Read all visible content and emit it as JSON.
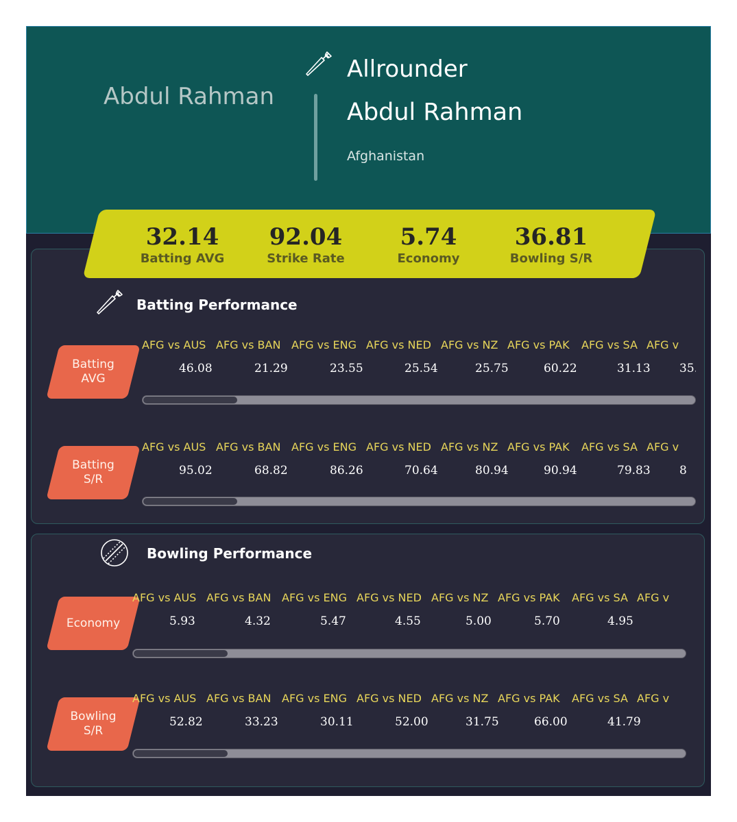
{
  "player": {
    "photo_name": "Abdul Rahman",
    "role": "Allrounder",
    "name": "Abdul Rahman",
    "country": "Afghanistan"
  },
  "summary": [
    {
      "value": "32.14",
      "label": "Batting AVG"
    },
    {
      "value": "92.04",
      "label": "Strike Rate"
    },
    {
      "value": "5.74",
      "label": "Economy"
    },
    {
      "value": "36.81",
      "label": "Bowling S/R"
    }
  ],
  "batting": {
    "title": "Batting Performance",
    "icon": "cricket-bat-icon",
    "rows": [
      {
        "label": "Batting\nAVG",
        "matches": [
          "AFG vs AUS",
          "AFG vs BAN",
          "AFG vs ENG",
          "AFG vs NED",
          "AFG vs NZ",
          "AFG vs PAK",
          "AFG vs SA",
          "AFG v"
        ],
        "values": [
          "46.08",
          "21.29",
          "23.55",
          "25.54",
          "25.75",
          "60.22",
          "31.13",
          "35."
        ],
        "scroll": 0.17
      },
      {
        "label": "Batting\nS/R",
        "matches": [
          "AFG vs AUS",
          "AFG vs BAN",
          "AFG vs ENG",
          "AFG vs NED",
          "AFG vs NZ",
          "AFG vs PAK",
          "AFG vs SA",
          "AFG v"
        ],
        "values": [
          "95.02",
          "68.82",
          "86.26",
          "70.64",
          "80.94",
          "90.94",
          "79.83",
          "8"
        ],
        "scroll": 0.17
      }
    ]
  },
  "bowling": {
    "title": "Bowling Performance",
    "icon": "cricket-ball-icon",
    "rows": [
      {
        "label": "Economy",
        "matches": [
          "AFG vs AUS",
          "AFG vs BAN",
          "AFG vs ENG",
          "AFG vs NED",
          "AFG vs NZ",
          "AFG vs PAK",
          "AFG vs SA",
          "AFG v"
        ],
        "values": [
          "5.93",
          "4.32",
          "5.47",
          "4.55",
          "5.00",
          "5.70",
          "4.95",
          ""
        ],
        "scroll": 0.17
      },
      {
        "label": "Bowling\nS/R",
        "matches": [
          "AFG vs AUS",
          "AFG vs BAN",
          "AFG vs ENG",
          "AFG vs NED",
          "AFG vs NZ",
          "AFG vs PAK",
          "AFG vs SA",
          "AFG v"
        ],
        "values": [
          "52.82",
          "33.23",
          "30.11",
          "52.00",
          "31.75",
          "66.00",
          "41.79",
          ""
        ],
        "scroll": 0.17
      }
    ]
  },
  "colors": {
    "hero": "#0e5655",
    "summary": "#d2d119",
    "tag": "#e8674b",
    "match_label": "#e8d65a"
  }
}
